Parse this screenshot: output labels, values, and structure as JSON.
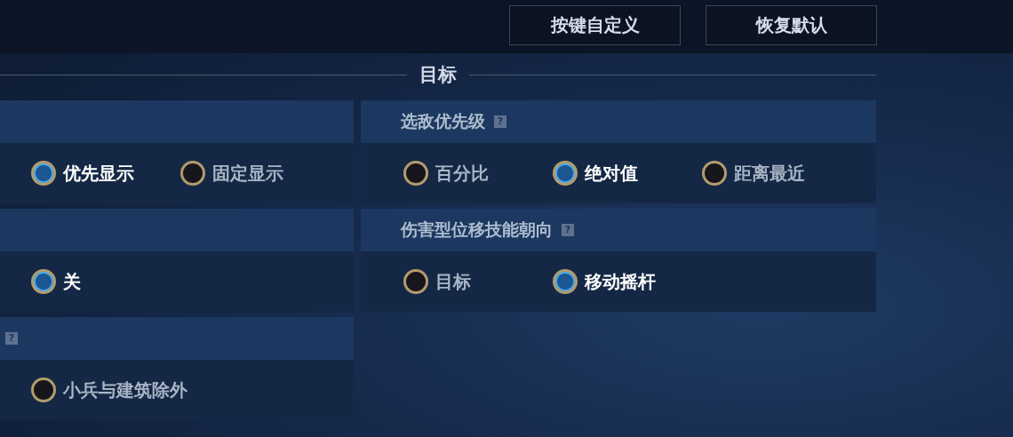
{
  "top_buttons": [
    {
      "label": "按键自定义"
    },
    {
      "label": "恢复默认"
    }
  ],
  "section": {
    "title": "目标"
  },
  "left_panels": [
    {
      "options": [
        {
          "label": "优先显示",
          "selected": true
        },
        {
          "label": "固定显示",
          "selected": false
        }
      ]
    },
    {
      "options": [
        {
          "label": "关",
          "selected": true
        }
      ]
    },
    {
      "help": "?",
      "options": [
        {
          "label": "小兵与建筑除外",
          "selected": false
        }
      ]
    }
  ],
  "right_panels": [
    {
      "title": "选敌优先级",
      "help": "?",
      "options": [
        {
          "label": "百分比",
          "selected": false
        },
        {
          "label": "绝对值",
          "selected": true
        },
        {
          "label": "距离最近",
          "selected": false
        }
      ]
    },
    {
      "title": "伤害型位移技能朝向",
      "help": "?",
      "options": [
        {
          "label": "目标",
          "selected": false
        },
        {
          "label": "移动摇杆",
          "selected": true
        }
      ]
    }
  ]
}
